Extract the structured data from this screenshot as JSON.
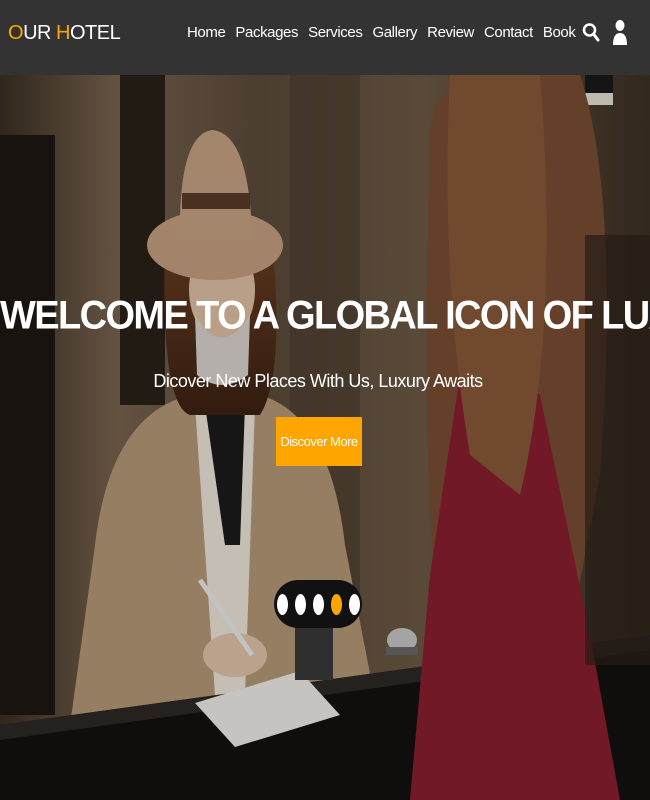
{
  "header": {
    "logo_first_letter": "O",
    "logo_part1": "UR ",
    "logo_accent_letter": "H",
    "logo_part2": "OTEL",
    "nav": [
      "Home",
      "Packages",
      "Services",
      "Gallery",
      "Review",
      "Contact",
      "Book"
    ],
    "icons": [
      "search-icon",
      "user-icon"
    ]
  },
  "hero": {
    "title": "WELCOME TO A GLOBAL ICON OF LUXURY",
    "subtitle": "Dicover New Places With Us, Luxury Awaits",
    "button_label": "Discover More",
    "slides": 5,
    "active_slide": 4
  },
  "colors": {
    "accent": "#ffa500",
    "header_bg": "#333333",
    "text": "#ffffff"
  }
}
